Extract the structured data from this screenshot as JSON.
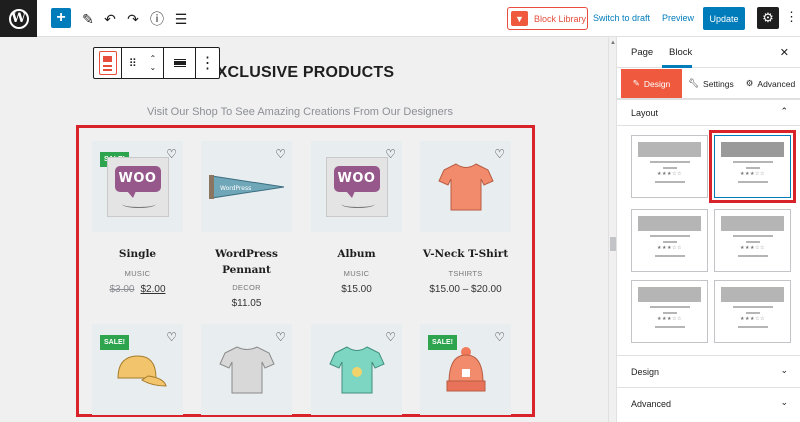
{
  "topbar": {
    "block_library_label": "Block Library",
    "switch_to_draft_label": "Switch to draft",
    "preview_label": "Preview",
    "update_label": "Update"
  },
  "content": {
    "heading": "EXCLUSIVE PRODUCTS",
    "subheading": "Visit Our Shop To See Amazing Creations From Our Designers",
    "sale_badge": "SALE!",
    "products": [
      {
        "name": "Single",
        "category": "MUSIC",
        "price_old": "$3.00",
        "price_new": "$2.00",
        "sale": true,
        "image": "woo-single"
      },
      {
        "name": "WordPress Pennant",
        "category": "DECOR",
        "price": "$11.05",
        "sale": false,
        "image": "pennant"
      },
      {
        "name": "Album",
        "category": "MUSIC",
        "price": "$15.00",
        "sale": false,
        "image": "woo-album"
      },
      {
        "name": "V-Neck T-Shirt",
        "category": "TSHIRTS",
        "price": "$15.00 – $20.00",
        "sale": false,
        "image": "tshirt-orange"
      },
      {
        "sale": true,
        "image": "cap"
      },
      {
        "sale": false,
        "image": "tshirt-grey"
      },
      {
        "sale": false,
        "image": "tshirt-teal"
      },
      {
        "sale": true,
        "image": "beanie"
      }
    ]
  },
  "sidebar": {
    "tab_page": "Page",
    "tab_block": "Block",
    "subtab_design": "Design",
    "subtab_settings": "Settings",
    "subtab_advanced": "Advanced",
    "section_layout": "Layout",
    "section_design": "Design",
    "section_advanced": "Advanced",
    "selected_layout": 2
  },
  "colors": {
    "accent": "#007cba",
    "brand": "#ef5a3f",
    "highlight": "#d8232a",
    "sale": "#2ea44f"
  }
}
